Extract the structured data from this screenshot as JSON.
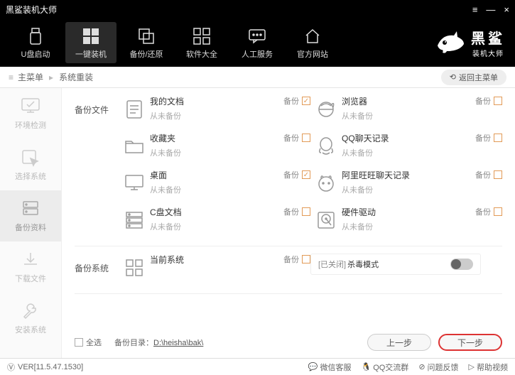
{
  "app_title": "黑鲨装机大师",
  "win": {
    "menu": "≡",
    "min": "—",
    "close": "×"
  },
  "topnav": [
    {
      "id": "usb",
      "label": "U盘启动"
    },
    {
      "id": "onekey",
      "label": "一键装机",
      "active": true
    },
    {
      "id": "backup",
      "label": "备份/还原"
    },
    {
      "id": "software",
      "label": "软件大全"
    },
    {
      "id": "service",
      "label": "人工服务"
    },
    {
      "id": "site",
      "label": "官方网站"
    }
  ],
  "brand": {
    "name": "黑鲨",
    "sub": "装机大师"
  },
  "crumb": {
    "icon": "≡",
    "root": "主菜单",
    "sep": "▸",
    "page": "系统重装",
    "back_icon": "⟲",
    "back": "返回主菜单"
  },
  "sidebar": [
    {
      "id": "env",
      "label": "环境检测"
    },
    {
      "id": "select",
      "label": "选择系统"
    },
    {
      "id": "data",
      "label": "备份资料",
      "active": true
    },
    {
      "id": "download",
      "label": "下载文件"
    },
    {
      "id": "install",
      "label": "安装系统"
    }
  ],
  "sections": {
    "files": "备份文件",
    "system": "备份系统"
  },
  "items": {
    "docs": {
      "name": "我的文档",
      "sub": "从未备份",
      "bk": "备份",
      "checked": true
    },
    "browser": {
      "name": "浏览器",
      "sub": "从未备份",
      "bk": "备份",
      "checked": false
    },
    "fav": {
      "name": "收藏夹",
      "sub": "从未备份",
      "bk": "备份",
      "checked": false
    },
    "qq": {
      "name": "QQ聊天记录",
      "sub": "从未备份",
      "bk": "备份",
      "checked": false
    },
    "desktop": {
      "name": "桌面",
      "sub": "从未备份",
      "bk": "备份",
      "checked": true
    },
    "ww": {
      "name": "阿里旺旺聊天记录",
      "sub": "从未备份",
      "bk": "备份",
      "checked": false
    },
    "cdisk": {
      "name": "C盘文档",
      "sub": "从未备份",
      "bk": "备份",
      "checked": false
    },
    "hw": {
      "name": "硬件驱动",
      "sub": "从未备份",
      "bk": "备份",
      "checked": false
    },
    "cursys": {
      "name": "当前系统",
      "bk": "备份",
      "checked": false
    }
  },
  "killmode": {
    "off": "[已关闭]",
    "label": "杀毒模式"
  },
  "footer": {
    "select_all": "全选",
    "dir_label": "备份目录：",
    "dir_path": "D:\\heisha\\bak\\",
    "prev": "上一步",
    "next": "下一步"
  },
  "status": {
    "ver_icon": "Ⓥ",
    "ver": "VER[11.5.47.1530]",
    "links": [
      {
        "icon": "💬",
        "label": "微信客服"
      },
      {
        "icon": "🐧",
        "label": "QQ交流群"
      },
      {
        "icon": "⊘",
        "label": "问题反馈"
      },
      {
        "icon": "▷",
        "label": "帮助视频"
      }
    ]
  }
}
